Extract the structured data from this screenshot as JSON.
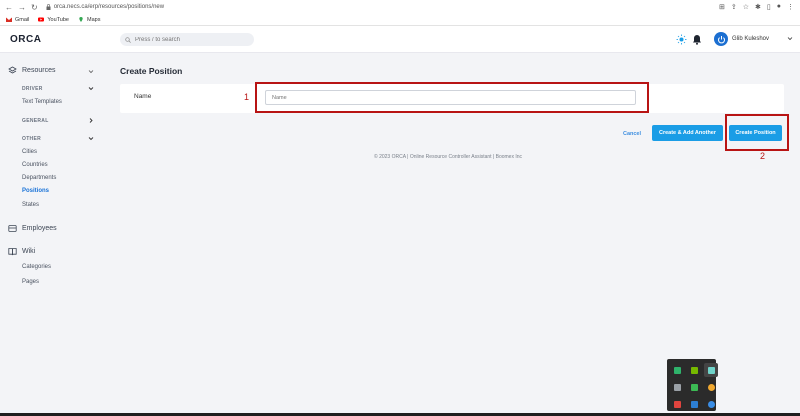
{
  "browser": {
    "url": "orca.necs.ca/erp/resources/positions/new",
    "bookmarks": [
      {
        "label": "Gmail",
        "icon": "gmail-icon",
        "color": "#d93025"
      },
      {
        "label": "YouTube",
        "icon": "youtube-icon",
        "color": "#ff0000"
      },
      {
        "label": "Maps",
        "icon": "maps-icon",
        "color": "#34a853"
      }
    ]
  },
  "header": {
    "logo": "ORCA",
    "search_placeholder": "Press / to search",
    "user_name": "Glib Kuleshov"
  },
  "sidebar": {
    "resources": "Resources",
    "driver": "DRIVER",
    "text_templates": "Text Templates",
    "general": "GENERAL",
    "other": "OTHER",
    "cities": "Cities",
    "countries": "Countries",
    "departments": "Departments",
    "positions": "Positions",
    "states": "States",
    "employees": "Employees",
    "wiki": "Wiki",
    "categories": "Categories",
    "pages": "Pages"
  },
  "main": {
    "title": "Create Position",
    "name_label": "Name",
    "name_placeholder": "Name",
    "cancel": "Cancel",
    "create_add_another": "Create & Add Another",
    "create_position": "Create Position",
    "footer": "© 2023 ORCA | Online Resource Controller Assistant | Boomex Inc"
  },
  "annotations": {
    "marker_1": "1",
    "marker_2": "2",
    "color": "#b81414"
  },
  "colors": {
    "accent": "#1a9de6",
    "active_link": "#1a73d8"
  }
}
